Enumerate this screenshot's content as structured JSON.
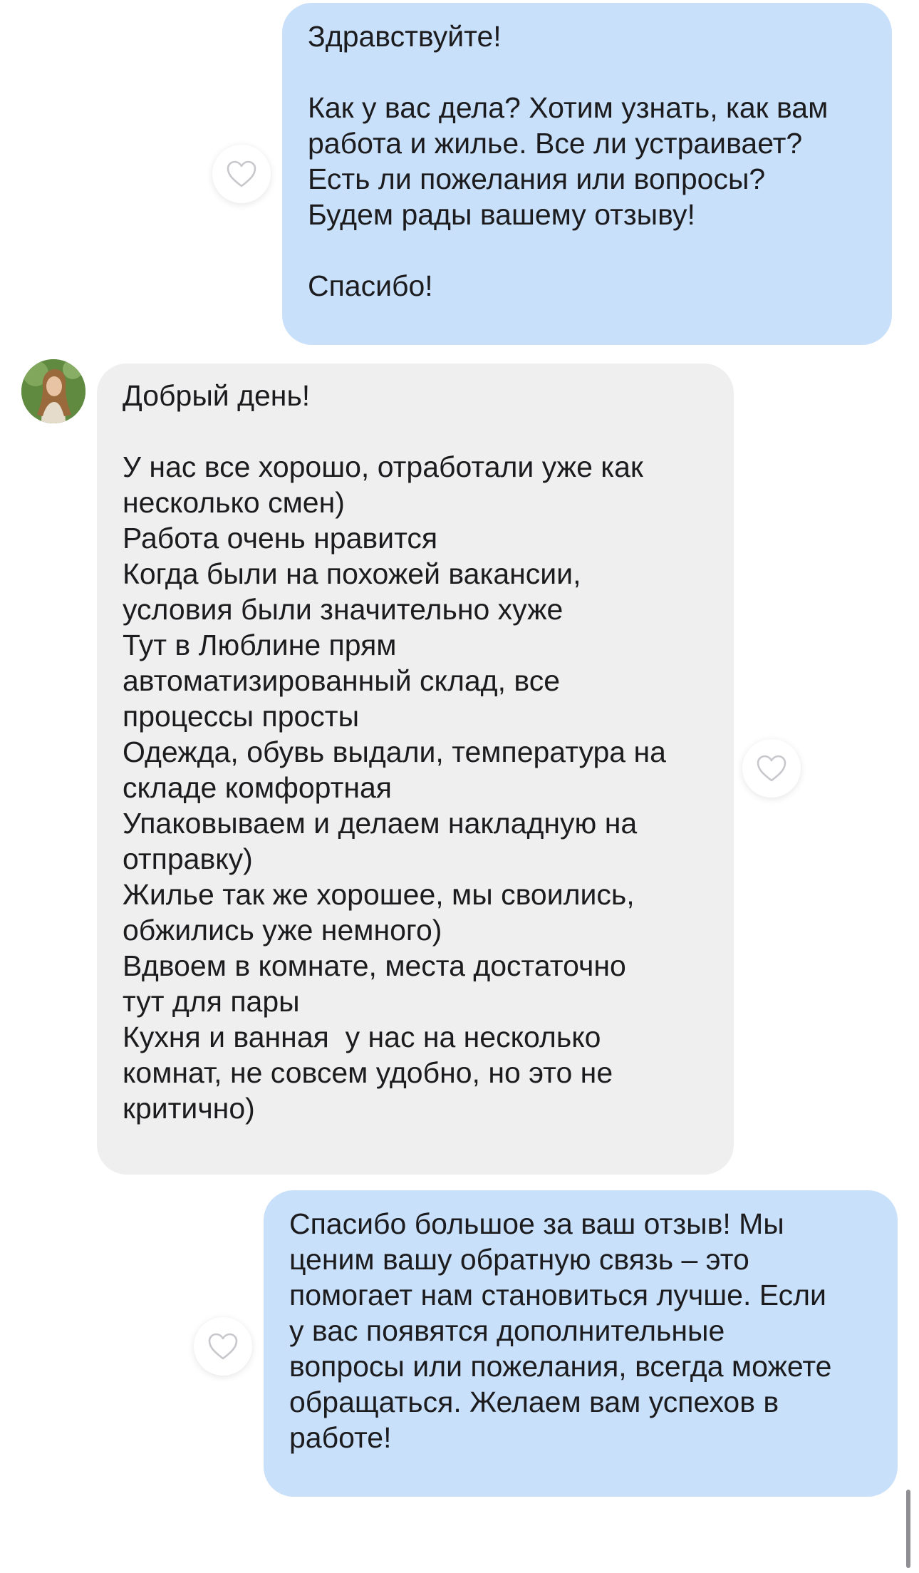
{
  "messages": [
    {
      "direction": "outgoing",
      "text": "Здравствуйте!\n\nКак у вас дела? Хотим узнать, как вам\nработа и жилье. Все ли устраивает?\nЕсть ли пожелания или вопросы?\nБудем рады вашему отзыву!\n\nСпасибо!"
    },
    {
      "direction": "incoming",
      "text": "Добрый день!\n\nУ нас все хорошо, отработали уже как\nнесколько смен)\nРабота очень нравится\nКогда были на похожей вакансии,\nусловия были значительно хуже\nТут в Люблине прям\nавтоматизированный склад, все\nпроцессы просты\nОдежда, обувь выдали, температура на\nскладе комфортная\nУпаковываем и делаем накладную на\nотправку)\nЖилье так же хорошее, мы своились,\nобжились уже немного)\nВдвоем в комнате, места достаточно\nтут для пары\nКухня и ванная  у нас на несколько\nкомнат, не совсем удобно, но это не\nкритично)"
    },
    {
      "direction": "outgoing",
      "text": "Спасибо большое за ваш отзыв! Мы\nценим вашу обратную связь – это\nпомогает нам становиться лучше. Если\nу вас появятся дополнительные\nвопросы или пожелания, всегда можете\nобращаться. Желаем вам успехов в\nработе!"
    }
  ],
  "icons": {
    "like": "heart-outline-icon",
    "avatar": "user-avatar"
  },
  "colors": {
    "outgoing_bubble": "#c9e0fb",
    "incoming_bubble": "#efeff0",
    "text": "#1c1c1e",
    "heart_stroke": "#c7c7cc"
  }
}
